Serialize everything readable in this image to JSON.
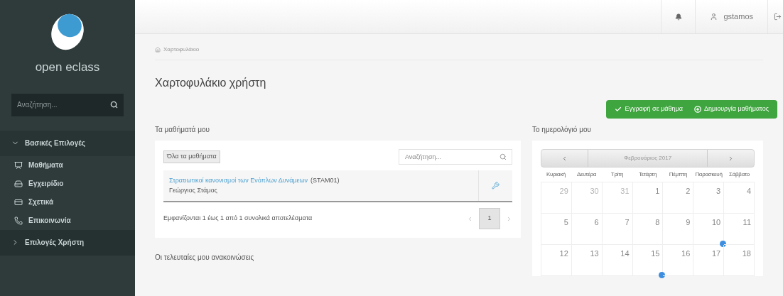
{
  "sidebar": {
    "logo": "open eclass",
    "search": {
      "placeholder": "Αναζήτηση..."
    },
    "sections": [
      {
        "label": "Βασικές Επιλογές",
        "expanded": true,
        "items": [
          {
            "label": "Μαθήματα"
          },
          {
            "label": "Εγχειρίδιο"
          },
          {
            "label": "Σχετικά"
          },
          {
            "label": "Επικοινωνία"
          }
        ]
      },
      {
        "label": "Επιλογές Χρήστη",
        "expanded": false
      }
    ]
  },
  "topbar": {
    "username": "gstamos"
  },
  "breadcrumb": "Χαρτοφυλάκιο",
  "title": "Χαρτοφυλάκιο χρήστη",
  "actions": [
    {
      "label": "Εγγραφή σε μάθημα"
    },
    {
      "label": "Δημιουργία μαθήματος"
    }
  ],
  "courses": {
    "heading": "Τα μαθήματά μου",
    "all_button": "Όλα τα μαθήματα",
    "search": {
      "placeholder": "Αναζήτηση..."
    },
    "rows": [
      {
        "title": "Στρατιωτικοί κανονισμοί των Ενόπλων Δυνάμεων",
        "code": "(STAM01)",
        "teacher": "Γεώργιος Στάμος"
      }
    ],
    "info": "Εμφανίζονται 1 έως 1 από 1 συνολικά αποτελέσματα",
    "pages": [
      {
        "label": "1",
        "selected": true
      }
    ]
  },
  "announcements": {
    "heading": "Οι τελευταίες μου ανακοινώσεις"
  },
  "calendar": {
    "heading": "Το ημερολόγιό μου",
    "month": "Φεβρουάριος 2017",
    "weekdays": [
      "Κυριακή",
      "Δευτέρα",
      "Τρίτη",
      "Τετάρτη",
      "Πέμπτη",
      "Παρασκευή",
      "Σάββατο"
    ],
    "weeks": [
      [
        {
          "day": "29",
          "muted": true,
          "event": false
        },
        {
          "day": "30",
          "muted": true,
          "event": false
        },
        {
          "day": "31",
          "muted": true,
          "event": false
        },
        {
          "day": "1",
          "muted": false,
          "event": false
        },
        {
          "day": "2",
          "muted": false,
          "event": false
        },
        {
          "day": "3",
          "muted": false,
          "event": false
        },
        {
          "day": "4",
          "muted": false,
          "event": false
        }
      ],
      [
        {
          "day": "5",
          "muted": false,
          "event": false
        },
        {
          "day": "6",
          "muted": false,
          "event": false
        },
        {
          "day": "7",
          "muted": false,
          "event": false
        },
        {
          "day": "8",
          "muted": false,
          "event": false
        },
        {
          "day": "9",
          "muted": false,
          "event": false
        },
        {
          "day": "10",
          "muted": false,
          "event": true
        },
        {
          "day": "11",
          "muted": false,
          "event": false
        }
      ],
      [
        {
          "day": "12",
          "muted": false,
          "event": false
        },
        {
          "day": "13",
          "muted": false,
          "event": false
        },
        {
          "day": "14",
          "muted": false,
          "event": false
        },
        {
          "day": "15",
          "muted": false,
          "event": true
        },
        {
          "day": "16",
          "muted": false,
          "event": false
        },
        {
          "day": "17",
          "muted": false,
          "event": false
        },
        {
          "day": "18",
          "muted": false,
          "event": false
        }
      ]
    ]
  }
}
